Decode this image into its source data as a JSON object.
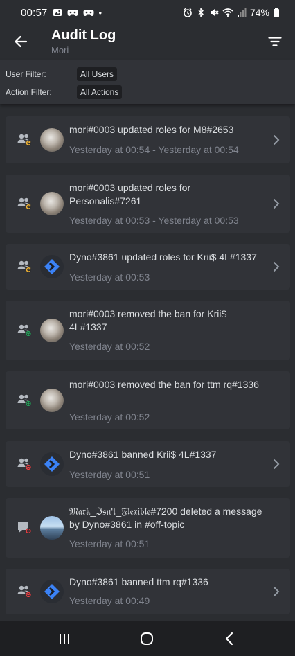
{
  "status_bar": {
    "time": "00:57",
    "dot": "•",
    "battery": "74%",
    "icons": [
      "gallery-icon",
      "game-controller-icon",
      "game-controller-icon",
      "alarm-icon",
      "bluetooth-icon",
      "mute-icon",
      "wifi-icon",
      "signal-icon",
      "battery-icon"
    ]
  },
  "header": {
    "title": "Audit Log",
    "subtitle": "Mori"
  },
  "filters": {
    "user_label": "User Filter:",
    "user_value": "All Users",
    "action_label": "Action Filter:",
    "action_value": "All Actions"
  },
  "entries": [
    {
      "action": "role-update",
      "avatar": "mori",
      "text": "mori#0003 updated roles for M8#2653",
      "time": "Yesterday at 00:54 - Yesterday at 00:54",
      "has_chevron": true
    },
    {
      "action": "role-update",
      "avatar": "mori",
      "text": "mori#0003 updated roles for Personalis#7261",
      "time": "Yesterday at 00:53 - Yesterday at 00:53",
      "has_chevron": true
    },
    {
      "action": "role-update",
      "avatar": "dyno",
      "text": "Dyno#3861 updated roles for Krii$ 4L#1337",
      "time": "Yesterday at 00:53",
      "has_chevron": true
    },
    {
      "action": "unban",
      "avatar": "mori",
      "text": "mori#0003 removed the ban for Krii$ 4L#1337",
      "time": "Yesterday at 00:52",
      "has_chevron": false
    },
    {
      "action": "unban",
      "avatar": "mori",
      "text": "mori#0003 removed the ban for ttm rq#1336",
      "time": "Yesterday at 00:52",
      "has_chevron": false
    },
    {
      "action": "ban",
      "avatar": "dyno",
      "text": "Dyno#3861 banned Krii$ 4L#1337",
      "time": "Yesterday at 00:51",
      "has_chevron": true
    },
    {
      "action": "message-delete",
      "avatar": "mark",
      "text": "𝔐𝔞𝔯𝔨_ℑ𝔰𝔫'𝔱_𝔉𝔩𝔢𝔵𝔦𝔟𝔩𝔢#7200 deleted a message by Dyno#3861 in #off-topic",
      "time": "Yesterday at 00:51",
      "has_chevron": false
    },
    {
      "action": "ban",
      "avatar": "dyno",
      "text": "Dyno#3861 banned ttm rq#1336",
      "time": "Yesterday at 00:49",
      "has_chevron": true
    }
  ],
  "colors": {
    "background": "#2b2d31",
    "card": "#313338",
    "text": "#dbdee1",
    "muted": "#80848e",
    "update_orange": "#f0b232",
    "add_green": "#23a55a",
    "remove_red": "#f23f43",
    "dyno_blue": "#3b82f6"
  }
}
